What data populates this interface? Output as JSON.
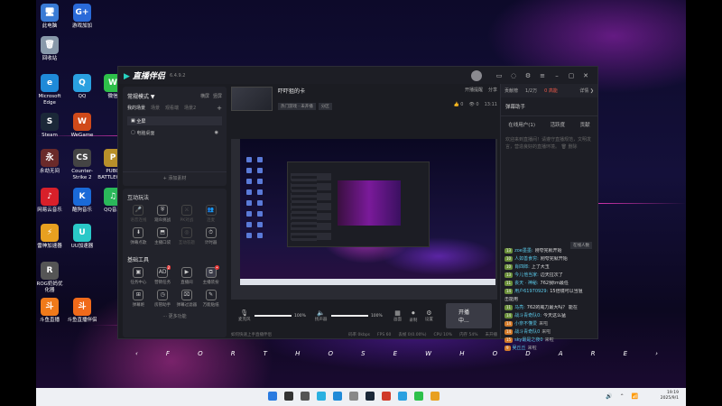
{
  "desktop": {
    "icons": [
      {
        "label": "此电脑",
        "glyph": "🖥",
        "color": "#3a7bd5"
      },
      {
        "label": "游戏加加",
        "glyph": "G+",
        "color": "#2a6ad8"
      },
      {
        "label": "回收站",
        "glyph": "🗑",
        "color": "#8899aa"
      },
      {
        "label": "Microsoft Edge",
        "glyph": "e",
        "color": "#1f8ad8"
      },
      {
        "label": "QQ",
        "glyph": "Q",
        "color": "#2aa0e0"
      },
      {
        "label": "微信",
        "glyph": "W",
        "color": "#2ec04a"
      },
      {
        "label": "Steam",
        "glyph": "S",
        "color": "#1b2838"
      },
      {
        "label": "WeGame",
        "glyph": "W",
        "color": "#d04a1a"
      },
      {
        "label": "永劫无间",
        "glyph": "永",
        "color": "#6a2a2a"
      },
      {
        "label": "Counter-Strike 2",
        "glyph": "CS",
        "color": "#444"
      },
      {
        "label": "PUBG BATTLEGR...",
        "glyph": "P",
        "color": "#b8902a"
      },
      {
        "label": "网易云音乐",
        "glyph": "♪",
        "color": "#d8202a"
      },
      {
        "label": "酷狗音乐",
        "glyph": "K",
        "color": "#1a6ad8"
      },
      {
        "label": "QQ音乐",
        "glyph": "♫",
        "color": "#2ab85a"
      },
      {
        "label": "雷神加速器",
        "glyph": "⚡",
        "color": "#e8a020"
      },
      {
        "label": "UU加速器",
        "glyph": "U",
        "color": "#2ac8c8"
      },
      {
        "label": "ROG奶妈优化器",
        "glyph": "R",
        "color": "#555"
      },
      {
        "label": "斗鱼直播",
        "glyph": "斗",
        "color": "#f07a1a"
      },
      {
        "label": "斗鱼直播伴侣",
        "glyph": "斗",
        "color": "#f06a1a"
      }
    ],
    "tagline": [
      "‹",
      "F",
      "O",
      "R",
      "T",
      "H",
      "O",
      "S",
      "E",
      "W",
      "H",
      "O",
      "D",
      "A",
      "R",
      "E",
      "›"
    ]
  },
  "app": {
    "logo": "直播伴侣",
    "version": "6.4.9.2",
    "scene": {
      "mode": "常规模式 ▼",
      "switches": [
        "横屏",
        "竖屏"
      ],
      "tabs": [
        "我的场景",
        "场景",
        "观看端",
        "场景2"
      ],
      "items": [
        "全屏",
        "电脑桌面"
      ],
      "add_source": "+ 添加素材"
    },
    "interact": {
      "title": "互动玩法",
      "tools": [
        {
          "icon": "🎤",
          "label": "语音连线",
          "dim": true
        },
        {
          "icon": "⛨",
          "label": "观众挑战",
          "dim": false
        },
        {
          "icon": "⚔",
          "label": "PK对战",
          "dim": true
        },
        {
          "icon": "👥",
          "label": "连麦",
          "dim": true
        },
        {
          "icon": "⬇",
          "label": "弹幕点歌",
          "dim": false
        },
        {
          "icon": "⬒",
          "label": "主播口袋",
          "dim": false
        },
        {
          "icon": "◎",
          "label": "互动答题",
          "dim": true
        },
        {
          "icon": "⏱",
          "label": "计时器",
          "dim": false
        }
      ]
    },
    "basic": {
      "title": "基础工具",
      "tools": [
        {
          "icon": "▣",
          "label": "任务中心",
          "badge": ""
        },
        {
          "icon": "AD",
          "label": "营销任务",
          "badge": "2"
        },
        {
          "icon": "▶",
          "label": "直播间",
          "badge": ""
        },
        {
          "icon": "⧉",
          "label": "主播装扮",
          "badge": "•"
        },
        {
          "icon": "⊞",
          "label": "弹幕姬",
          "badge": ""
        },
        {
          "icon": "◷",
          "label": "房管助手",
          "badge": ""
        },
        {
          "icon": "⌧",
          "label": "弹幕过滤器",
          "badge": ""
        },
        {
          "icon": "✎",
          "label": "万能贴纸",
          "badge": ""
        }
      ],
      "more": "··· 更多功能"
    },
    "room": {
      "title": "吓吓狙的卡",
      "tags": [
        "热门游戏 · 未开播",
        "分区"
      ],
      "actions": [
        "开播提醒",
        "分享"
      ],
      "stats": [
        "👍 0",
        "👁 0",
        "13:11"
      ]
    },
    "controls": {
      "mic_label": "麦克风",
      "mic_pct": "100%",
      "speaker_label": "扬声器",
      "speaker_pct": "100%",
      "buttons": [
        "画面",
        "录制",
        "设置"
      ],
      "go_live": "开播中..."
    },
    "status": {
      "hint": "如何快速上手直播伴侣",
      "items": [
        "码率 0kbps",
        "FPS 60",
        "丢帧 0(0.00%)",
        "CPU 10%",
        "内存 54%",
        "未开播"
      ]
    },
    "right": {
      "tabs": [
        "贡献榜",
        "1/2万",
        "0 高能",
        "详情 ❯"
      ],
      "assistant": "弹幕助手",
      "subtabs": [
        "在线用户(1)",
        "活跃度",
        "贡献"
      ],
      "notice": "欢迎来到直播间！请遵守直播规范，文明发言，营造良好的直播环境。",
      "notice_delete": "🗑 删除",
      "count": "在线人数",
      "messages": [
        {
          "lv": "13",
          "user": "zoe墨墨:",
          "text": "刚夸完就开始",
          "o": false
        },
        {
          "lv": "10",
          "user": "人如善食穷:",
          "text": "刚夸完就开始",
          "o": false
        },
        {
          "lv": "10",
          "user": "肖四郎:",
          "text": "上了大玉",
          "o": false
        },
        {
          "lv": "13",
          "user": "今儿他当家:",
          "text": "边天拉次了",
          "o": false
        },
        {
          "lv": "11",
          "user": "丧天 · 神秘:",
          "text": "762我tm最任",
          "o": false
        },
        {
          "lv": "14",
          "user": "用户61970929:",
          "text": "15倍镜可以当狙",
          "o": false
        },
        {
          "lv": "",
          "user": "",
          "text": "击能用",
          "o": false
        },
        {
          "lv": "11",
          "user": "马亮:",
          "text": "762的威力最大吗？ 能在",
          "o": false
        },
        {
          "lv": "14",
          "user": "战斗青奇队0:",
          "text": "今天这么猛",
          "o": false
        },
        {
          "lv": "14",
          "user": "小奈不懂爱",
          "text": "来啦",
          "o": true
        },
        {
          "lv": "14",
          "user": "战斗青奇队0",
          "text": "来啦",
          "o": true
        },
        {
          "lv": "15",
          "user": "sky最是之夜0",
          "text": "来啦",
          "o": true
        },
        {
          "lv": "9",
          "user": "吴丘丘",
          "text": "来啦",
          "o": true
        }
      ]
    }
  },
  "taskbar": {
    "apps": [
      "#2a7be0",
      "#333",
      "#555",
      "#2ab0e0",
      "#1f8ad8",
      "#888",
      "#1b2838",
      "#d03a2a",
      "#2aa0e0",
      "#2ec04a",
      "#e8a020"
    ],
    "tray_icons": "🔊 ⌃ 📶",
    "time": "19:19",
    "date": "2025/9/1"
  }
}
